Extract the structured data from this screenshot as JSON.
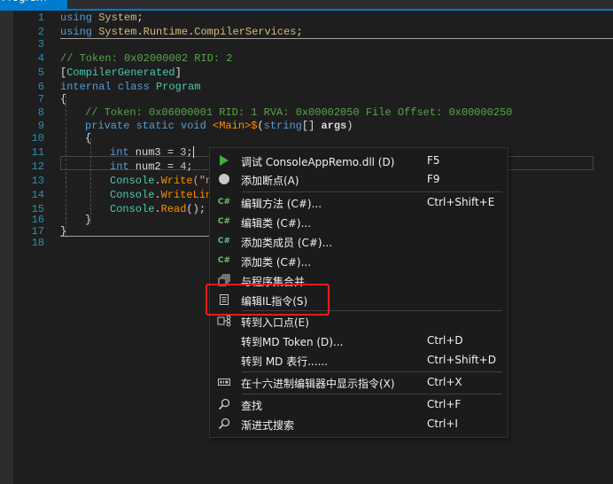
{
  "tab": {
    "title": "Program",
    "close": "✕"
  },
  "code_lines": [
    {
      "n": "1"
    },
    {
      "n": "2"
    },
    {
      "n": "3"
    },
    {
      "n": "4"
    },
    {
      "n": "5"
    },
    {
      "n": "6"
    },
    {
      "n": "7"
    },
    {
      "n": "8"
    },
    {
      "n": "9"
    },
    {
      "n": "10"
    },
    {
      "n": "11"
    },
    {
      "n": "12"
    },
    {
      "n": "13"
    },
    {
      "n": "14"
    },
    {
      "n": "15"
    },
    {
      "n": "16"
    },
    {
      "n": "17"
    },
    {
      "n": "18"
    }
  ],
  "code": {
    "l1": {
      "kw": "using",
      "ns": "System",
      "end": ";"
    },
    "l2": {
      "kw": "using",
      "ns1": "System",
      "ns2": "Runtime",
      "ns3": "CompilerServices",
      "end": ";"
    },
    "l4": {
      "comment": "// Token: 0x02000002 RID: 2"
    },
    "l5": {
      "open": "[",
      "type": "CompilerGenerated",
      "close": "]"
    },
    "l6": {
      "kw": "internal class",
      "type": "Program"
    },
    "l7": {
      "text": "{"
    },
    "l8": {
      "comment": "// Token: 0x06000001 RID: 1 RVA: 0x00002050 File Offset: 0x00000250"
    },
    "l9": {
      "kw": "private static void",
      "method": "<Main>$",
      "p1": "(",
      "ptype": "string",
      "p2": "[] ",
      "pname": "args",
      "p3": ")"
    },
    "l10": {
      "text": "{"
    },
    "l11": {
      "kw": "int",
      "var": " num3 = ",
      "num": "3",
      "end": ";"
    },
    "l12": {
      "kw": "int",
      "var": " num2 = ",
      "num": "4",
      "end": ";"
    },
    "l13": {
      "type": "Console",
      "dot": ".",
      "method": "Write",
      "rest": "(\"n"
    },
    "l14": {
      "type": "Console",
      "dot": ".",
      "method": "WriteLin"
    },
    "l15": {
      "type": "Console",
      "dot": ".",
      "method": "Read",
      "rest": "();"
    },
    "l16": {
      "text": "}"
    },
    "l17": {
      "text": "}"
    }
  },
  "context_menu": {
    "items": [
      {
        "label": "调试 ConsoleAppRemo.dll (D)",
        "shortcut": "F5",
        "icon": "play-icon"
      },
      {
        "label": "添加断点(A)",
        "shortcut": "F9",
        "icon": "breakpoint-icon"
      },
      {
        "label": "编辑方法 (C#)...",
        "shortcut": "Ctrl+Shift+E",
        "icon": "csharp-icon"
      },
      {
        "label": "编辑类 (C#)...",
        "shortcut": "",
        "icon": "csharp-icon"
      },
      {
        "label": "添加类成员 (C#)...",
        "shortcut": "",
        "icon": "csharp-icon"
      },
      {
        "label": "添加类 (C#)...",
        "shortcut": "",
        "icon": "csharp-icon"
      },
      {
        "label": "与程序集合并...",
        "shortcut": "",
        "icon": "merge-icon"
      },
      {
        "label": "编辑IL指令(S)",
        "shortcut": "",
        "icon": "document-icon",
        "highlighted": true
      },
      {
        "label": "转到入口点(E)",
        "shortcut": "",
        "icon": "entrypoint-icon"
      },
      {
        "label": "转到MD Token (D)...",
        "shortcut": "Ctrl+D",
        "icon": ""
      },
      {
        "label": "转到 MD 表行......",
        "shortcut": "Ctrl+Shift+D",
        "icon": ""
      },
      {
        "label": "在十六进制编辑器中显示指令(X)",
        "shortcut": "Ctrl+X",
        "icon": "hex-icon"
      },
      {
        "label": "查找",
        "shortcut": "Ctrl+F",
        "icon": "search-icon"
      },
      {
        "label": "渐进式搜索",
        "shortcut": "Ctrl+I",
        "icon": "search-icon"
      }
    ],
    "csharp_glyph": "C#"
  },
  "colors": {
    "accent": "#007acc",
    "highlight_box": "#ff1a1a"
  }
}
